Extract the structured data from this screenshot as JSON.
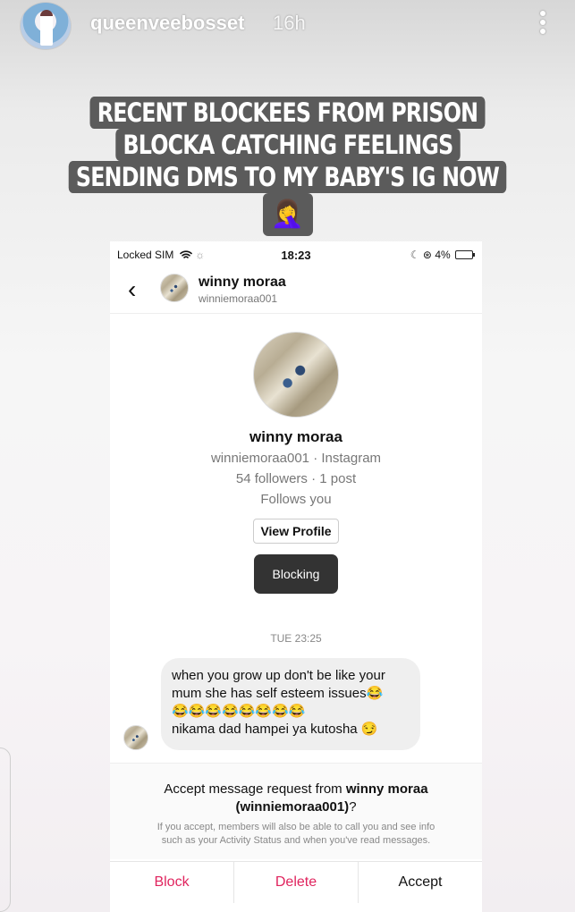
{
  "story": {
    "username": "queenveebosset",
    "time_ago": "16h"
  },
  "caption": {
    "lines": [
      "RECENT BLOCKEES FROM PRISON",
      "BLOCKA CATCHING FEELINGS",
      "SENDING DMS TO MY BABY'S IG NOW"
    ],
    "emoji": "🤦‍♀️"
  },
  "status_bar": {
    "carrier": "Locked SIM",
    "time": "18:23",
    "battery": "4%"
  },
  "chat_header": {
    "back_glyph": "‹",
    "name": "winny moraa",
    "username": "winniemoraa001"
  },
  "profile": {
    "name": "winny moraa",
    "handle_line": "winniemoraa001 · Instagram",
    "stats_line": "54 followers · 1 post",
    "follows_line": "Follows you",
    "view_profile_label": "View Profile",
    "blocking_label": "Blocking"
  },
  "thread": {
    "timestamp": "TUE 23:25",
    "message_lines": [
      "when you grow up don't be like your",
      "mum she has self esteem issues😂",
      "😂😂😂😂😂😂😂😂",
      "nikama dad hampei ya kutosha 😏"
    ]
  },
  "request": {
    "title_prefix": "Accept message request from ",
    "title_name": "winny moraa",
    "title_handle": "(winniemoraa001)",
    "title_suffix": "?",
    "info_line1": "If you accept, members will also be able to call you and see info",
    "info_line2": "such as your Activity Status and when you've read messages.",
    "block_label": "Block",
    "delete_label": "Delete",
    "accept_label": "Accept"
  },
  "colors": {
    "danger": "#e0245e",
    "blocking_bg": "#333333",
    "caption_bg": "#5b5b5b"
  }
}
